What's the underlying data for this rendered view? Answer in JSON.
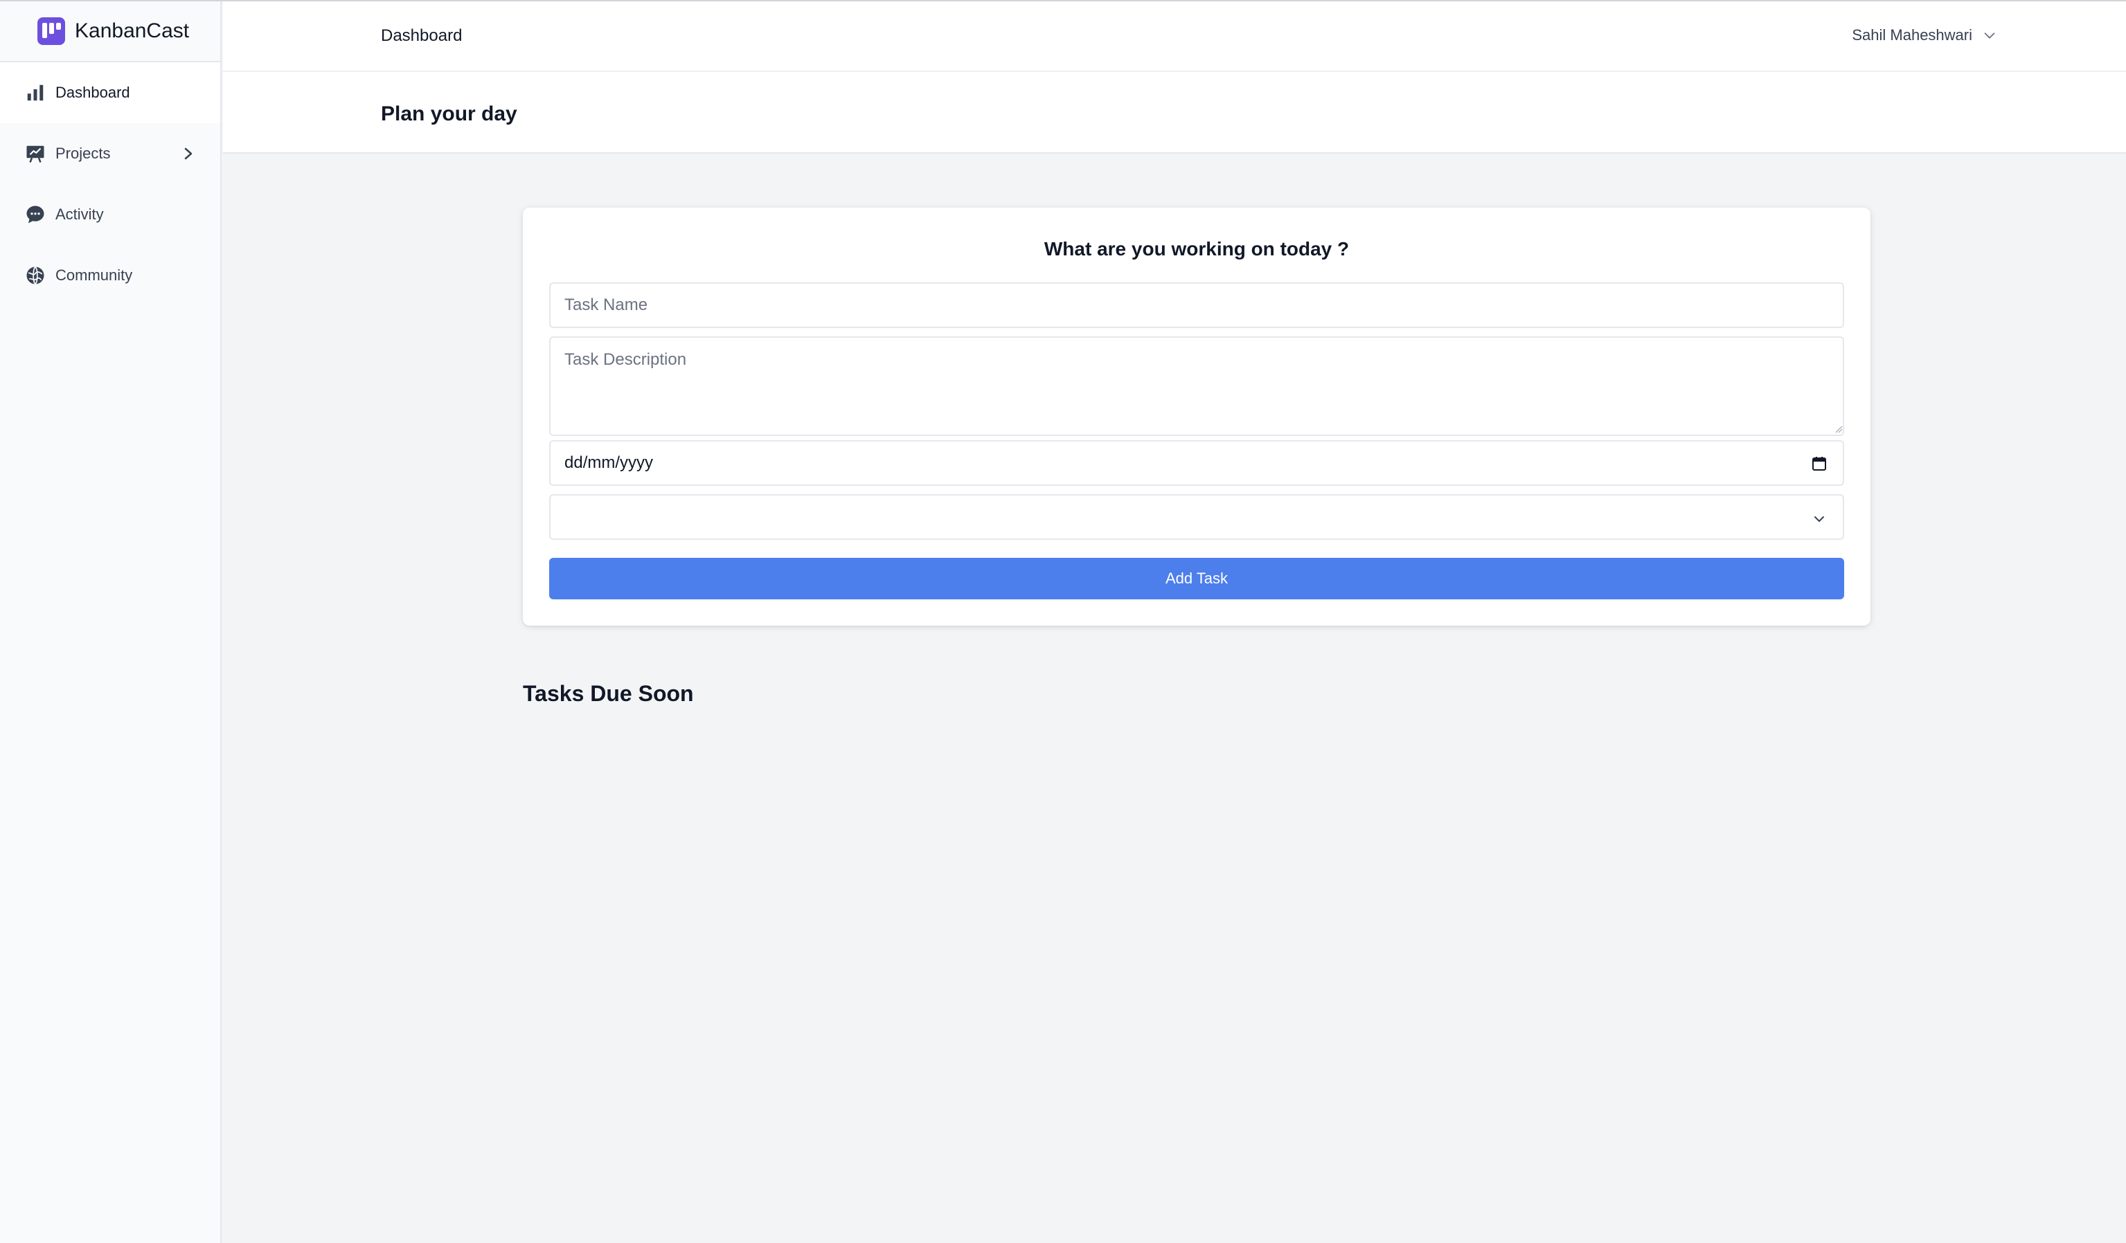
{
  "app": {
    "name": "KanbanCast"
  },
  "sidebar": {
    "items": [
      {
        "label": "Dashboard",
        "icon": "bar-chart-icon",
        "active": true
      },
      {
        "label": "Projects",
        "icon": "presentation-chart-icon",
        "has_submenu": true
      },
      {
        "label": "Activity",
        "icon": "chat-bubble-icon"
      },
      {
        "label": "Community",
        "icon": "globe-icon"
      }
    ]
  },
  "header": {
    "title": "Dashboard",
    "user_name": "Sahil Maheshwari"
  },
  "page": {
    "title": "Plan your day"
  },
  "task_form": {
    "heading": "What are you working on today ?",
    "task_name_placeholder": "Task Name",
    "task_description_placeholder": "Task Description",
    "date_placeholder": "dd/mm/yyyy",
    "select_value": "",
    "submit_label": "Add Task"
  },
  "tasks_due": {
    "heading": "Tasks Due Soon"
  },
  "colors": {
    "accent": "#4c7fec",
    "brand": "#6d4fe0",
    "sidebar_bg": "#f9fafb",
    "page_bg": "#f3f4f6"
  }
}
